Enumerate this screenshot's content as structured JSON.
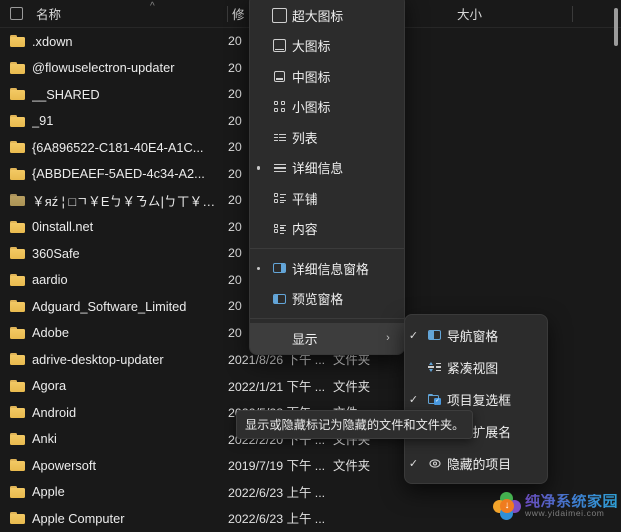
{
  "file_list": {
    "columns": [
      {
        "key": "name",
        "label": "名称"
      },
      {
        "key": "modified",
        "label": "修"
      },
      {
        "key": "type",
        "label": ""
      },
      {
        "key": "size",
        "label": "大小"
      }
    ],
    "sort_indicator": "^",
    "rows": [
      {
        "icon": "folder-icon",
        "name": ".xdown",
        "modified": "20",
        "type": "",
        "size": ""
      },
      {
        "icon": "folder-icon",
        "name": "@flowuselectron-updater",
        "modified": "20",
        "type": "",
        "size": ""
      },
      {
        "icon": "folder-icon",
        "name": "__SHARED",
        "modified": "20",
        "type": "",
        "size": ""
      },
      {
        "icon": "folder-icon",
        "name": "_91",
        "modified": "20",
        "type": "",
        "size": ""
      },
      {
        "icon": "folder-icon",
        "name": "{6A896522-C181-40E4-A1C...",
        "modified": "20",
        "type": "",
        "size": ""
      },
      {
        "icon": "folder-icon",
        "name": "{ABBDEAEF-5AED-4c34-A2...",
        "modified": "20",
        "type": "",
        "size": ""
      },
      {
        "icon": "folder-icon-dim",
        "name": "￥яź ¦ □ㄱ￥Eㄅ￥ㄋㄙ|ㄅㄒ￥оӽ￥...",
        "modified": "20",
        "type": "",
        "size": ""
      },
      {
        "icon": "folder-icon",
        "name": "0install.net",
        "modified": "20",
        "type": "",
        "size": ""
      },
      {
        "icon": "folder-icon",
        "name": "360Safe",
        "modified": "20",
        "type": "",
        "size": ""
      },
      {
        "icon": "folder-icon",
        "name": "aardio",
        "modified": "20",
        "type": "",
        "size": ""
      },
      {
        "icon": "folder-icon",
        "name": "Adguard_Software_Limited",
        "modified": "20",
        "type": "",
        "size": ""
      },
      {
        "icon": "folder-icon",
        "name": "Adobe",
        "modified": "20",
        "type": "",
        "size": ""
      },
      {
        "icon": "folder-icon",
        "name": "adrive-desktop-updater",
        "modified": "2021/8/26 下午 ...",
        "type": "文件夹",
        "size": ""
      },
      {
        "icon": "folder-icon",
        "name": "Agora",
        "modified": "2022/1/21 下午 ...",
        "type": "文件夹",
        "size": ""
      },
      {
        "icon": "folder-icon",
        "name": "Android",
        "modified": "2022/5/28 下午 ...",
        "type": "文件",
        "size": ""
      },
      {
        "icon": "folder-icon",
        "name": "Anki",
        "modified": "2022/2/20 下午 ...",
        "type": "文件夹",
        "size": ""
      },
      {
        "icon": "folder-icon",
        "name": "Apowersoft",
        "modified": "2019/7/19 下午 ...",
        "type": "文件夹",
        "size": ""
      },
      {
        "icon": "folder-icon",
        "name": "Apple",
        "modified": "2022/6/23 上午 ...",
        "type": "",
        "size": ""
      },
      {
        "icon": "folder-icon",
        "name": "Apple Computer",
        "modified": "2022/6/23 上午 ...",
        "type": "",
        "size": ""
      }
    ]
  },
  "view_menu": {
    "items": [
      {
        "label": "超大图标",
        "icon": "extra-large-icons-icon",
        "selected": false
      },
      {
        "label": "大图标",
        "icon": "large-icons-icon",
        "selected": false
      },
      {
        "label": "中图标",
        "icon": "medium-icons-icon",
        "selected": false
      },
      {
        "label": "小图标",
        "icon": "small-icons-icon",
        "selected": false
      },
      {
        "label": "列表",
        "icon": "list-view-icon",
        "selected": false
      },
      {
        "label": "详细信息",
        "icon": "details-view-icon",
        "selected": true
      },
      {
        "label": "平铺",
        "icon": "tiles-view-icon",
        "selected": false
      },
      {
        "label": "内容",
        "icon": "content-view-icon",
        "selected": false
      },
      {
        "label": "详细信息窗格",
        "icon": "details-pane-icon",
        "selected": true
      },
      {
        "label": "预览窗格",
        "icon": "preview-pane-icon",
        "selected": false
      },
      {
        "label": "显示",
        "icon": "",
        "selected": false,
        "submenu": true,
        "highlighted": true,
        "chevron": "›"
      }
    ]
  },
  "display_submenu": {
    "items": [
      {
        "label": "导航窗格",
        "icon": "navigation-pane-icon",
        "checked": true
      },
      {
        "label": "紧凑视图",
        "icon": "compact-view-icon",
        "checked": false
      },
      {
        "label": "项目复选框",
        "icon": "item-checkboxes-icon",
        "checked": true
      },
      {
        "label": "文件扩展名",
        "icon": "file-extensions-icon",
        "checked": true
      },
      {
        "label": "隐藏的项目",
        "icon": "hidden-items-icon",
        "checked": true
      }
    ],
    "check_glyph": "✓"
  },
  "tooltip": {
    "text": "显示或隐藏标记为隐藏的文件和文件夹。"
  },
  "watermark": {
    "title": "纯净系统家园",
    "url": "www.yidaimei.com",
    "logo_glyph": "↓"
  }
}
